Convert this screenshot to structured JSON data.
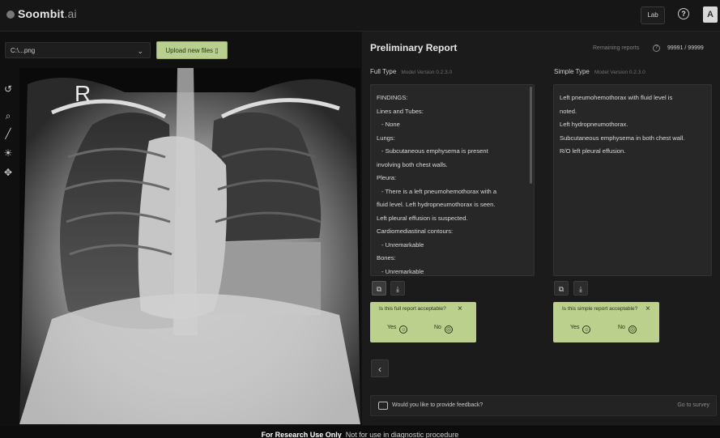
{
  "app": {
    "brand": "Soombit",
    "brand_suffix": ".ai"
  },
  "header": {
    "lab_label": "Lab",
    "help_icon": "question-circle-icon",
    "avatar_letter": "A"
  },
  "viewer": {
    "file_select_value": "C:\\...png",
    "upload_label": "Upload new files",
    "tools": [
      "reset-icon",
      "zoom-icon",
      "measure-icon",
      "brightness-icon",
      "pan-icon"
    ],
    "image_marker": "R"
  },
  "report": {
    "title": "Preliminary Report",
    "remaining_label": "Remaining reports",
    "remaining_count": "99991 / 99999",
    "full": {
      "type_label": "Full Type",
      "version": "Model Version 0.2.3.0",
      "lines": [
        "FINDINGS:",
        "Lines and Tubes:",
        "- None",
        "Lungs:",
        "- Subcutaneous emphysema is present",
        "involving both chest walls.",
        "Pleura:",
        "- There is a left pneumohemothorax with a",
        "fluid level. Left hydropneumothorax is seen.",
        "Left pleural effusion is suspected.",
        "Cardiomediastinal contours:",
        "- Unremarkable",
        "Bones:",
        "- Unremarkable"
      ],
      "question": "Is this full report acceptable?",
      "yes": "Yes",
      "no": "No"
    },
    "simple": {
      "type_label": "Simple Type",
      "version": "Model Version 0.2.3.0",
      "lines": [
        "Left pneumohemothorax with fluid level is",
        "noted.",
        "Left hydropneumothorax.",
        "Subcutaneous emphysema in both chest wall.",
        "R/O left pleural effusion."
      ],
      "question": "Is this simple report acceptable?",
      "yes": "Yes",
      "no": "No"
    },
    "feedback_text": "Would you like to provide feedback?",
    "survey_link": "Go to survey"
  },
  "footer": {
    "bold": "For Research Use Only",
    "text": "Not for use in diagnostic procedure"
  }
}
